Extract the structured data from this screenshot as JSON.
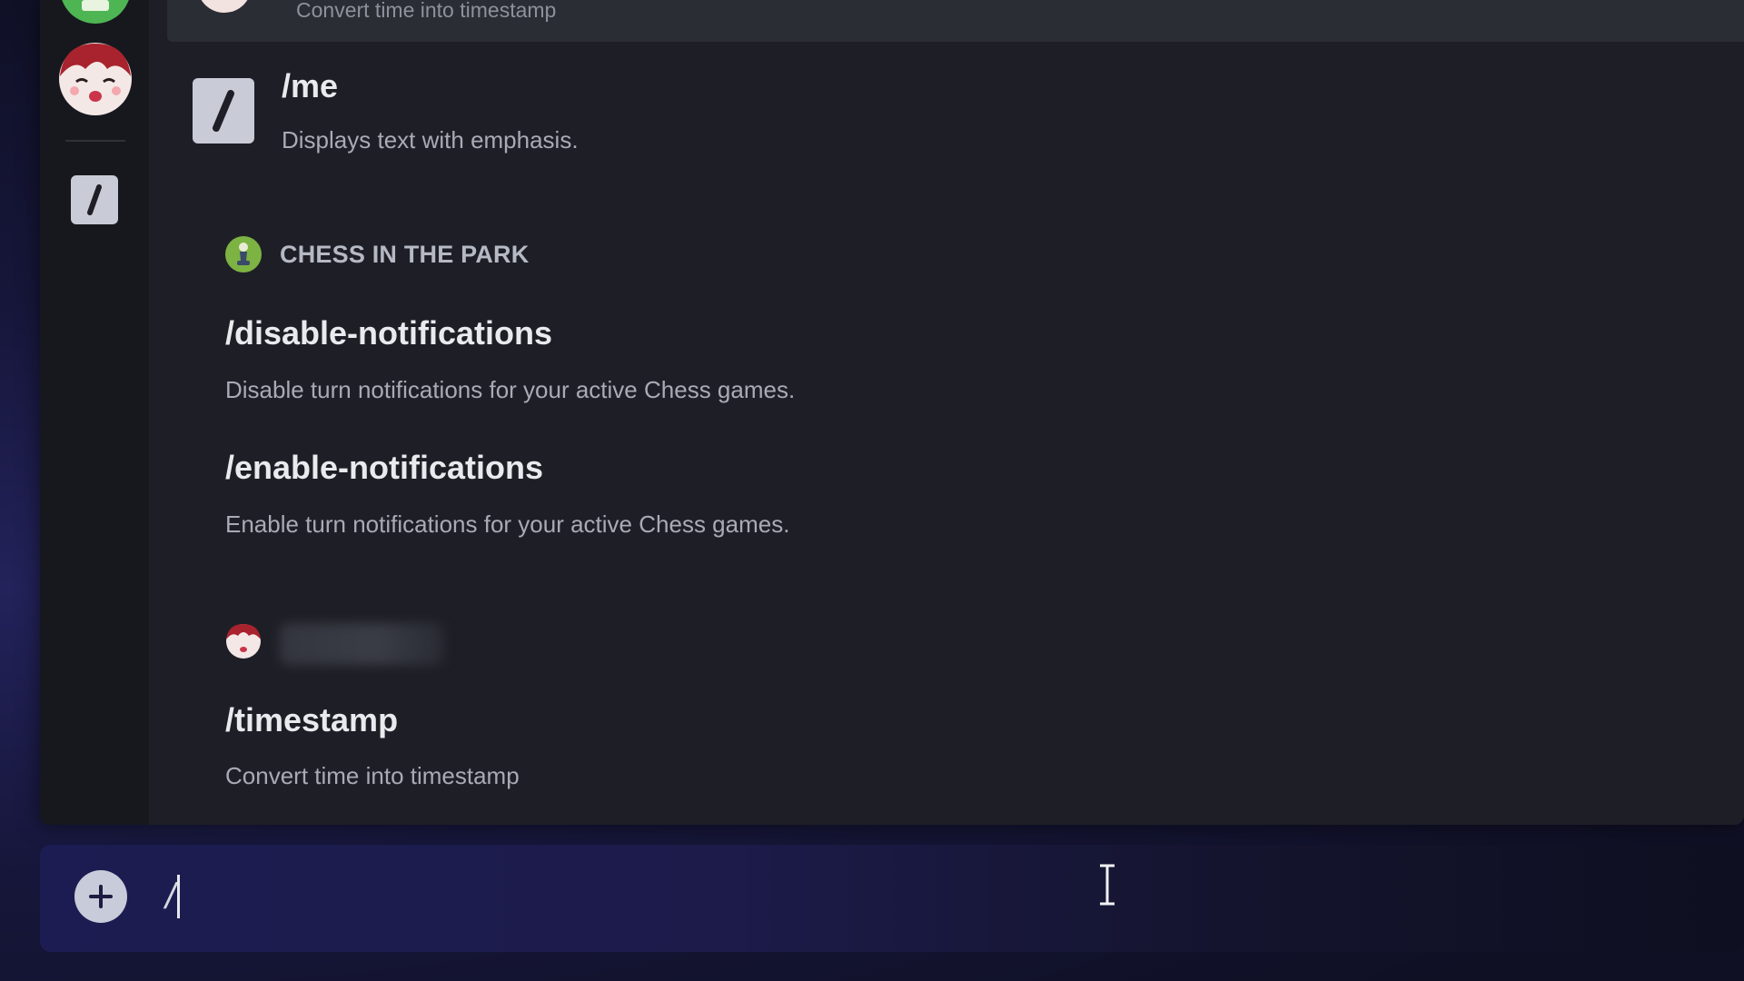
{
  "popup": {
    "top_item": {
      "description": "Convert time into timestamp",
      "avatar_icon": "anime-avatar-icon"
    },
    "rail": {
      "items": [
        {
          "icon": "green-app-icon"
        },
        {
          "icon": "anime-avatar-icon"
        },
        {
          "icon": "slash-command-icon"
        }
      ]
    },
    "builtin": {
      "commands": [
        {
          "name": "/me",
          "description": "Displays text with emphasis.",
          "icon": "slash-command-icon"
        }
      ]
    },
    "sections": [
      {
        "name": "CHESS IN THE PARK",
        "icon": "chess-icon",
        "commands": [
          {
            "name": "/disable-notifications",
            "description": "Disable turn notifications for your active Chess games."
          },
          {
            "name": "/enable-notifications",
            "description": "Enable turn notifications for your active Chess games."
          }
        ]
      },
      {
        "name": "",
        "icon": "anime-avatar-icon",
        "commands": [
          {
            "name": "/timestamp",
            "description": "Convert time into timestamp"
          }
        ]
      }
    ]
  },
  "input": {
    "value": "/",
    "add_icon": "plus-circle-icon"
  },
  "colors": {
    "popup_bg": "#1e1f26",
    "rail_bg": "#17181d",
    "accent_green": "#4eb553",
    "input_bg": "#1d1c52"
  }
}
